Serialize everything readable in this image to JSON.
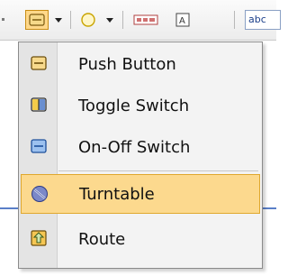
{
  "toolbar": {
    "abc_label": "abc"
  },
  "menu": {
    "items": [
      {
        "label": "Push Button",
        "icon": "push-button-icon",
        "highlighted": false
      },
      {
        "label": "Toggle Switch",
        "icon": "toggle-switch-icon",
        "highlighted": false
      },
      {
        "label": "On-Off Switch",
        "icon": "on-off-switch-icon",
        "highlighted": false
      },
      {
        "label": "Turntable",
        "icon": "turntable-icon",
        "highlighted": true
      },
      {
        "label": "Route",
        "icon": "route-icon",
        "highlighted": false
      }
    ]
  },
  "colors": {
    "highlight": "#fcd98e",
    "highlight_border": "#e0a82e",
    "pressed": "#ffd88a"
  }
}
